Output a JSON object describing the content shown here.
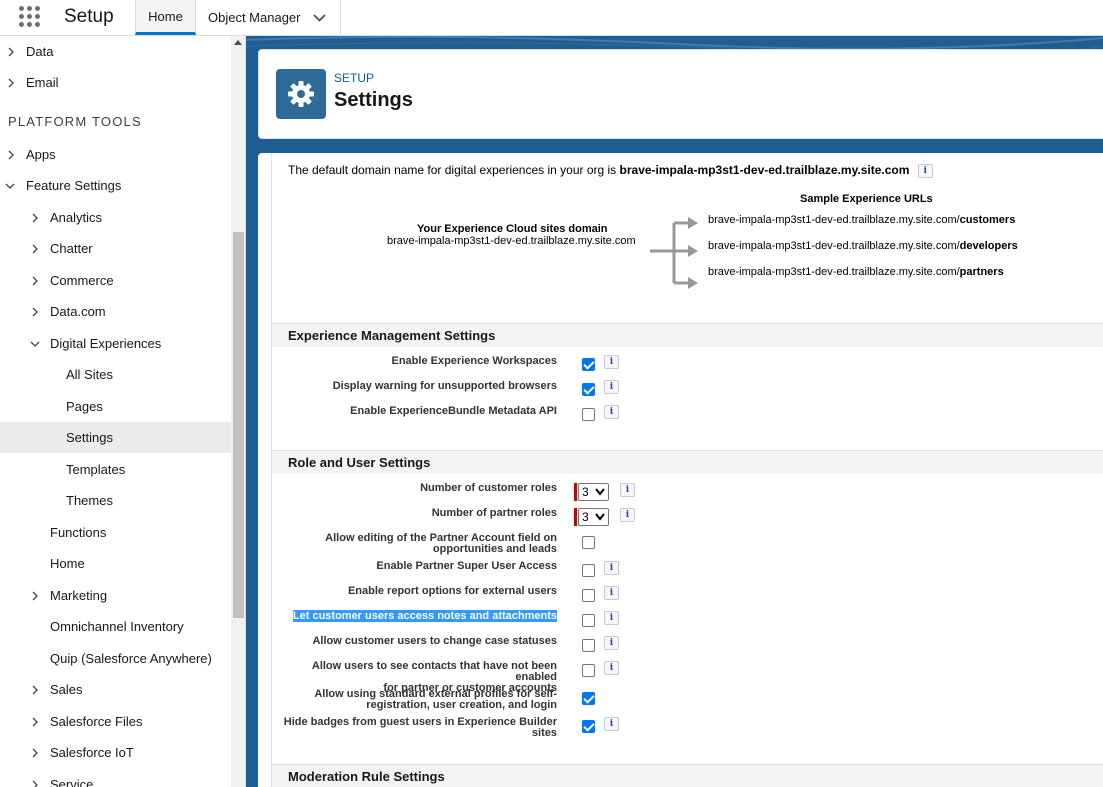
{
  "topbar": {
    "app_name": "Setup",
    "tabs": [
      {
        "label": "Home"
      },
      {
        "label": "Object Manager"
      }
    ]
  },
  "sidebar": {
    "heading": "PLATFORM TOOLS",
    "items": [
      {
        "label": "Data",
        "arrow": "right"
      },
      {
        "label": "Email",
        "arrow": "right"
      },
      {
        "label": "Apps",
        "arrow": "right"
      },
      {
        "label": "Feature Settings",
        "arrow": "down"
      },
      {
        "label": "Analytics",
        "arrow": "right"
      },
      {
        "label": "Chatter",
        "arrow": "right"
      },
      {
        "label": "Commerce",
        "arrow": "right"
      },
      {
        "label": "Data.com",
        "arrow": "right"
      },
      {
        "label": "Digital Experiences",
        "arrow": "down"
      },
      {
        "label": "All Sites"
      },
      {
        "label": "Pages"
      },
      {
        "label": "Settings"
      },
      {
        "label": "Templates"
      },
      {
        "label": "Themes"
      },
      {
        "label": "Functions"
      },
      {
        "label": "Home"
      },
      {
        "label": "Marketing",
        "arrow": "right"
      },
      {
        "label": "Omnichannel Inventory"
      },
      {
        "label": "Quip (Salesforce Anywhere)"
      },
      {
        "label": "Sales",
        "arrow": "right"
      },
      {
        "label": "Salesforce Files",
        "arrow": "right"
      },
      {
        "label": "Salesforce IoT",
        "arrow": "right"
      },
      {
        "label": "Service",
        "arrow": "right"
      }
    ]
  },
  "header": {
    "breadcrumb": "SETUP",
    "title": "Settings"
  },
  "domain": {
    "intro": "The default domain name for digital experiences in your org is ",
    "value": "brave-impala-mp3st1-dev-ed.trailblaze.my.site.com",
    "diagram_title": "Sample Experience URLs",
    "site_domain_label": "Your Experience Cloud sites domain",
    "site_domain_value": "brave-impala-mp3st1-dev-ed.trailblaze.my.site.com",
    "url_base": "brave-impala-mp3st1-dev-ed.trailblaze.my.site.com/",
    "url_paths": [
      "customers",
      "developers",
      "partners"
    ]
  },
  "sections": {
    "experience_management": {
      "title": "Experience Management Settings",
      "rows": [
        {
          "label": "Enable Experience Workspaces",
          "checked": true,
          "info": true
        },
        {
          "label": "Display warning for unsupported browsers",
          "checked": true,
          "info": true
        },
        {
          "label": "Enable ExperienceBundle Metadata API",
          "checked": false,
          "info": true
        }
      ]
    },
    "role_user": {
      "title": "Role and User Settings",
      "selects": [
        {
          "label": "Number of customer roles",
          "value": "3"
        },
        {
          "label": "Number of partner roles",
          "value": "3"
        }
      ],
      "rows": [
        {
          "label_1": "Allow editing of the Partner Account field on",
          "label_2": "opportunities and leads",
          "checked": false,
          "info": false
        },
        {
          "label_1": "Enable Partner Super User Access",
          "checked": false,
          "info": true
        },
        {
          "label_1": "Enable report options for external users",
          "checked": false,
          "info": true
        },
        {
          "label_1": "Let customer users access notes and attachments",
          "checked": false,
          "info": true,
          "highlighted": true
        },
        {
          "label_1": "Allow customer users to change case statuses",
          "checked": false,
          "info": true
        },
        {
          "label_1": "Allow users to see contacts that have not been enabled",
          "label_2": "for partner or customer accounts",
          "checked": false,
          "info": true
        },
        {
          "label_1": "Allow using standard external profiles for self-",
          "label_2": "registration, user creation, and login",
          "checked": true,
          "info": false
        },
        {
          "label_1": "Hide badges from guest users in Experience Builder",
          "label_2": "sites",
          "checked": true,
          "info": true
        }
      ]
    },
    "moderation": {
      "title": "Moderation Rule Settings"
    }
  },
  "info_glyph": "i",
  "colors": {
    "brand": "#1f5e93",
    "accent": "#0176d3",
    "checkbox_checked": "#0075ff",
    "required": "#c00000",
    "highlight": "#3399ff"
  }
}
